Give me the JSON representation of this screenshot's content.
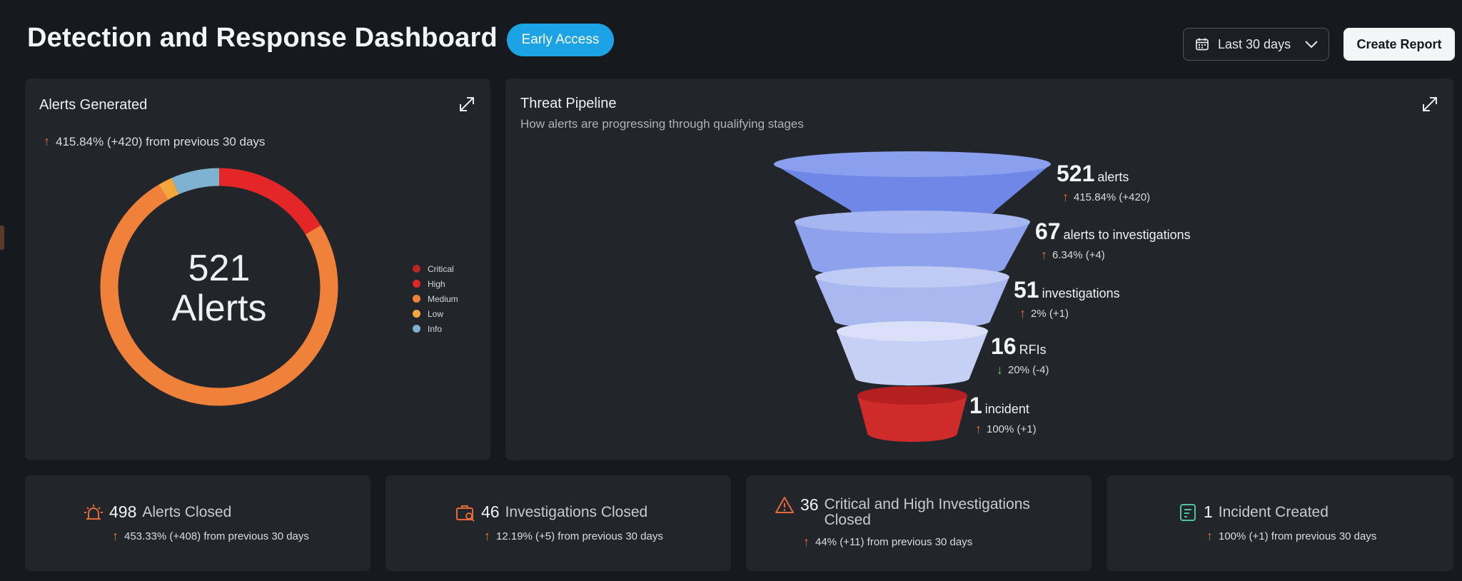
{
  "header": {
    "title": "Detection and Response Dashboard",
    "badge": "Early Access",
    "date_range": "Last 30 days",
    "create_report": "Create Report"
  },
  "alerts_panel": {
    "title": "Alerts Generated",
    "trend": "415.84% (+420) from previous 30 days",
    "center_value": "521",
    "center_label": "Alerts",
    "legend": [
      {
        "label": "Critical",
        "color": "#b82626"
      },
      {
        "label": "High",
        "color": "#e32626"
      },
      {
        "label": "Medium",
        "color": "#f0813a"
      },
      {
        "label": "Low",
        "color": "#f5a63d"
      },
      {
        "label": "Info",
        "color": "#7fb2d0"
      }
    ]
  },
  "chart_data": {
    "type": "pie",
    "variant": "donut",
    "categories": [
      "Critical",
      "High",
      "Medium",
      "Low",
      "Info"
    ],
    "values": [
      0,
      85,
      392,
      10,
      34
    ],
    "colors": [
      "#b82626",
      "#e32626",
      "#f0813a",
      "#f5a63d",
      "#7fb2d0"
    ],
    "center_text": "521 Alerts",
    "legend_position": "right"
  },
  "pipeline_panel": {
    "title": "Threat Pipeline",
    "subtitle": "How alerts are progressing through qualifying stages",
    "stages": [
      {
        "value": "521",
        "label": "alerts",
        "change": "415.84% (+420)",
        "direction": "up",
        "color": "#6f87e6"
      },
      {
        "value": "67",
        "label": "alerts to investigations",
        "change": "6.34% (+4)",
        "direction": "up",
        "color": "#8ea1ec"
      },
      {
        "value": "51",
        "label": "investigations",
        "change": "2% (+1)",
        "direction": "up",
        "color": "#aab8f0"
      },
      {
        "value": "16",
        "label": "RFIs",
        "change": "20% (-4)",
        "direction": "down",
        "color": "#c6d0f5"
      },
      {
        "value": "1",
        "label": "incident",
        "change": "100% (+1)",
        "direction": "up",
        "color": "#cf2b2b"
      }
    ]
  },
  "stats": [
    {
      "icon": "alarm-icon",
      "num": "498",
      "label": "Alerts Closed",
      "change": "453.33% (+408) from previous 30 days",
      "icon_color": "#e6693a"
    },
    {
      "icon": "briefcase-search-icon",
      "num": "46",
      "label": "Investigations Closed",
      "change": "12.19% (+5) from previous 30 days",
      "icon_color": "#e6693a"
    },
    {
      "icon": "warning-icon",
      "num": "36",
      "label": "Critical and High Investigations",
      "label2": "Closed",
      "change": "44% (+11) from previous 30 days",
      "icon_color": "#e6693a"
    },
    {
      "icon": "incident-note-icon",
      "num": "1",
      "label": "Incident Created",
      "change": "100% (+1) from previous 30 days",
      "icon_color": "#4fc3a1"
    }
  ]
}
